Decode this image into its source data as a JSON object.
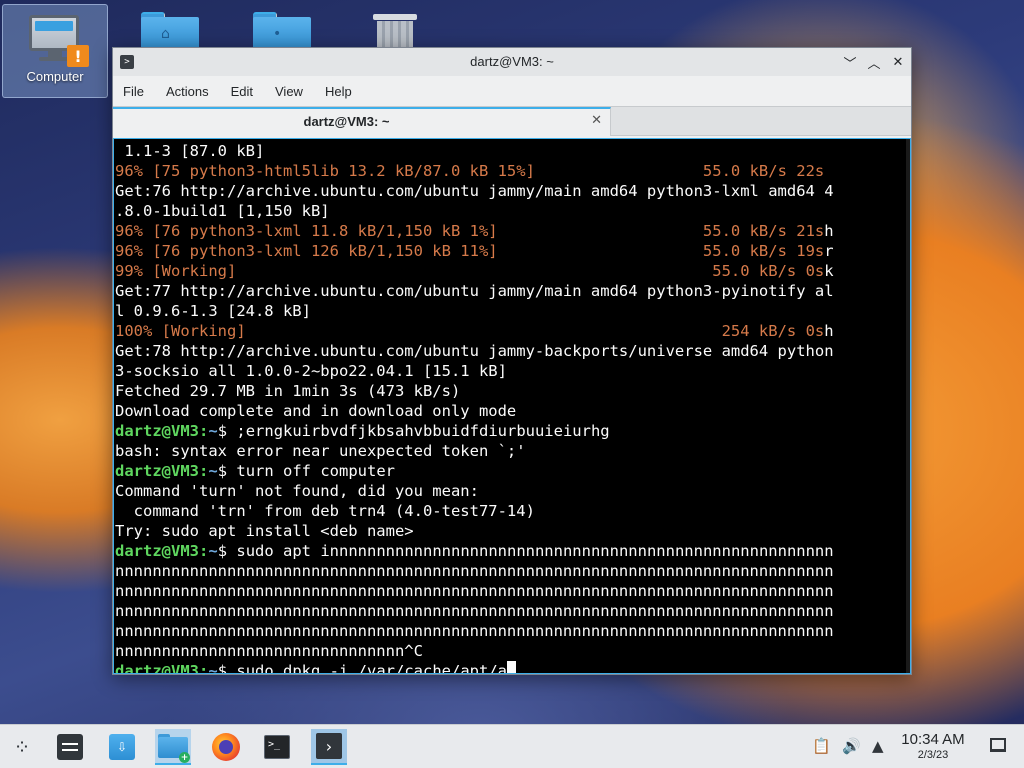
{
  "desktop": {
    "computer_label": "Computer"
  },
  "window": {
    "title": "dartz@VM3: ~",
    "menu": [
      "File",
      "Actions",
      "Edit",
      "View",
      "Help"
    ],
    "tab_label": "dartz@VM3: ~"
  },
  "terminal": {
    "lines": [
      {
        "text": " 1.1-3 [87.0 kB]",
        "color": "white"
      },
      {
        "text": "96% [75 python3-html5lib 13.2 kB/87.0 kB 15%]",
        "color": "orange",
        "right": "55.0 kB/s 22s",
        "right_col": 63
      },
      {
        "text": "Get:76 http://archive.ubuntu.com/ubuntu jammy/main amd64 python3-lxml amd64 4",
        "color": "white"
      },
      {
        "text": ".8.0-1build1 [1,150 kB]",
        "color": "white"
      },
      {
        "text": "96% [76 python3-lxml 11.8 kB/1,150 kB 1%]",
        "color": "orange",
        "right": "55.0 kB/s 21s",
        "right_col": 63,
        "tail": "h"
      },
      {
        "text": "96% [76 python3-lxml 126 kB/1,150 kB 11%]",
        "color": "orange",
        "right": "55.0 kB/s 19s",
        "right_col": 63,
        "tail": "r"
      },
      {
        "text": "99% [Working]",
        "color": "orange",
        "right": "55.0 kB/s 0s",
        "right_col": 64,
        "tail": "k"
      },
      {
        "text": "Get:77 http://archive.ubuntu.com/ubuntu jammy/main amd64 python3-pyinotify al",
        "color": "white"
      },
      {
        "text": "l 0.9.6-1.3 [24.8 kB]",
        "color": "white"
      },
      {
        "text": "100% [Working]",
        "color": "orange",
        "right": "254 kB/s 0s",
        "right_col": 65,
        "tail": "h"
      },
      {
        "text": "Get:78 http://archive.ubuntu.com/ubuntu jammy-backports/universe amd64 python",
        "color": "white"
      },
      {
        "text": "3-socksio all 1.0.0-2~bpo22.04.1 [15.1 kB]",
        "color": "white"
      },
      {
        "text": "Fetched 29.7 MB in 1min 3s (473 kB/s)",
        "color": "white"
      },
      {
        "text": "Download complete and in download only mode",
        "color": "white"
      },
      {
        "prompt": true,
        "user": "dartz@VM3",
        "path": "~",
        "cmd": " ;erngkuirbvdfjkbsahvbbuidfdiurbuuieiurhg"
      },
      {
        "text": "bash: syntax error near unexpected token `;'",
        "color": "white"
      },
      {
        "prompt": true,
        "user": "dartz@VM3",
        "path": "~",
        "cmd": " turn off computer"
      },
      {
        "text": "Command 'turn' not found, did you mean:",
        "color": "white"
      },
      {
        "text": "  command 'trn' from deb trn4 (4.0-test77-14)",
        "color": "white"
      },
      {
        "text": "Try: sudo apt install <deb name>",
        "color": "white"
      },
      {
        "prompt": true,
        "user": "dartz@VM3",
        "path": "~",
        "cmd": " sudo apt innnnnnnnnnnnnnnnnnnnnnnnnnnnnnnnnnnnnnnnnnnnnnnnnnnnnn"
      },
      {
        "text": "nnnnnnnnnnnnnnnnnnnnnnnnnnnnnnnnnnnnnnnnnnnnnnnnnnnnnnnnnnnnnnnnnnnnnnnnnnnnn",
        "color": "white"
      },
      {
        "text": "nnnnnnnnnnnnnnnnnnnnnnnnnnnnnnnnnnnnnnnnnnnnnnnnnnnnnnnnnnnnnnnnnnnnnnnnnnnnn",
        "color": "white"
      },
      {
        "text": "nnnnnnnnnnnnnnnnnnnnnnnnnnnnnnnnnnnnnnnnnnnnnnnnnnnnnnnnnnnnnnnnnnnnnnnnnnnnn",
        "color": "white"
      },
      {
        "text": "nnnnnnnnnnnnnnnnnnnnnnnnnnnnnnnnnnnnnnnnnnnnnnnnnnnnnnnnnnnnnnnnnnnnnnnnnnnnn",
        "color": "white"
      },
      {
        "text": "nnnnnnnnnnnnnnnnnnnnnnnnnnnnnnn^C",
        "color": "white"
      },
      {
        "prompt": true,
        "user": "dartz@VM3",
        "path": "~",
        "cmd": " sudo dpkg -i /var/cache/apt/a",
        "cursor": true
      }
    ]
  },
  "taskbar": {
    "time": "10:34 AM",
    "date": "2/3/23"
  },
  "colors": {
    "prompt_user": "#5fd75f",
    "prompt_path": "#6fa8dc",
    "progress_orange": "#d67a4a",
    "accent": "#3daee9"
  }
}
